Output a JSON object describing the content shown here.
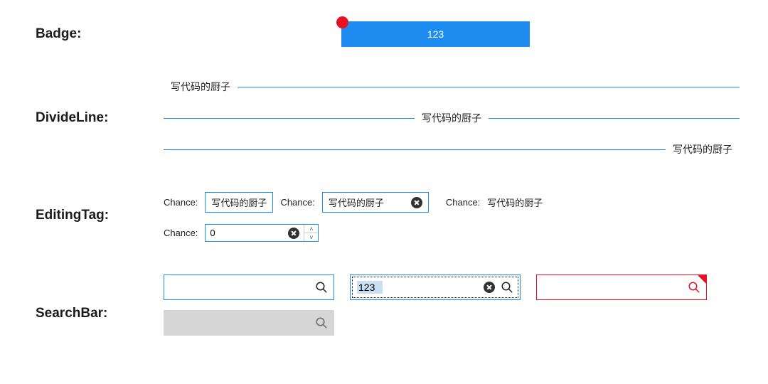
{
  "labels": {
    "badge": "Badge:",
    "divide": "DivideLine:",
    "editing": "EditingTag:",
    "search": "SearchBar:"
  },
  "badge": {
    "button_text": "123"
  },
  "divide": {
    "text_left": "写代码的厨子",
    "text_center": "写代码的厨子",
    "text_right": "写代码的厨子"
  },
  "editing": {
    "chance_label": "Chance:",
    "tag1": "写代码的厨子",
    "tag2": "写代码的厨子",
    "tag3": "写代码的厨子",
    "num_value": "0"
  },
  "search": {
    "s1_value": "",
    "s2_value": "123",
    "s3_value": "",
    "s4_value": ""
  },
  "colors": {
    "primary": "#1e8cf0",
    "error": "#e81123"
  }
}
